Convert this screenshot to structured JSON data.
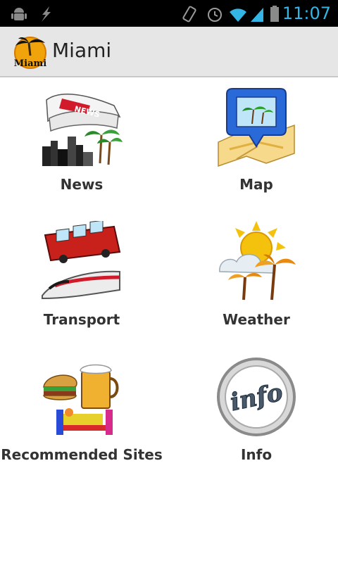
{
  "status_bar": {
    "time": "11:07",
    "icons": [
      "android-icon",
      "usb-debug-icon",
      "vibrate-icon",
      "alarm-icon",
      "wifi-icon",
      "signal-icon",
      "battery-icon"
    ]
  },
  "app_bar": {
    "title": "Miami",
    "logo_text": "Miami"
  },
  "grid": {
    "tiles": [
      {
        "label": "News",
        "icon": "news-icon"
      },
      {
        "label": "Map",
        "icon": "map-icon"
      },
      {
        "label": "Transport",
        "icon": "transport-icon"
      },
      {
        "label": "Weather",
        "icon": "weather-icon"
      },
      {
        "label": "Recommended Sites",
        "icon": "recommended-sites-icon"
      },
      {
        "label": "Info",
        "icon": "info-icon"
      }
    ],
    "info_text": "info",
    "news_text": "NEWS"
  },
  "colors": {
    "status_bar": "#000000",
    "clock": "#33b5e5",
    "action_bar": "#e6e6e6",
    "label": "#333333"
  }
}
